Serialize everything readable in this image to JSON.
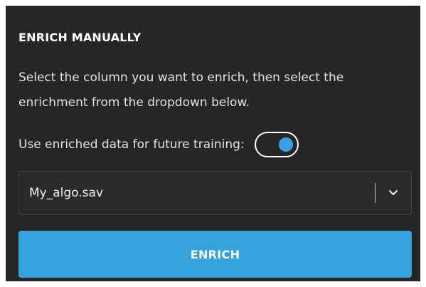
{
  "panel": {
    "title": "ENRICH MANUALLY",
    "description": "Select the column you want to enrich, then select the enrichment from the dropdown below."
  },
  "toggle": {
    "label": "Use enriched data for future training:",
    "state": "on",
    "accent_color": "#3aa0e4"
  },
  "select": {
    "value": "My_algo.sav",
    "icon": "chevron-down-icon"
  },
  "button": {
    "label": "ENRICH",
    "color": "#36a3dc"
  }
}
